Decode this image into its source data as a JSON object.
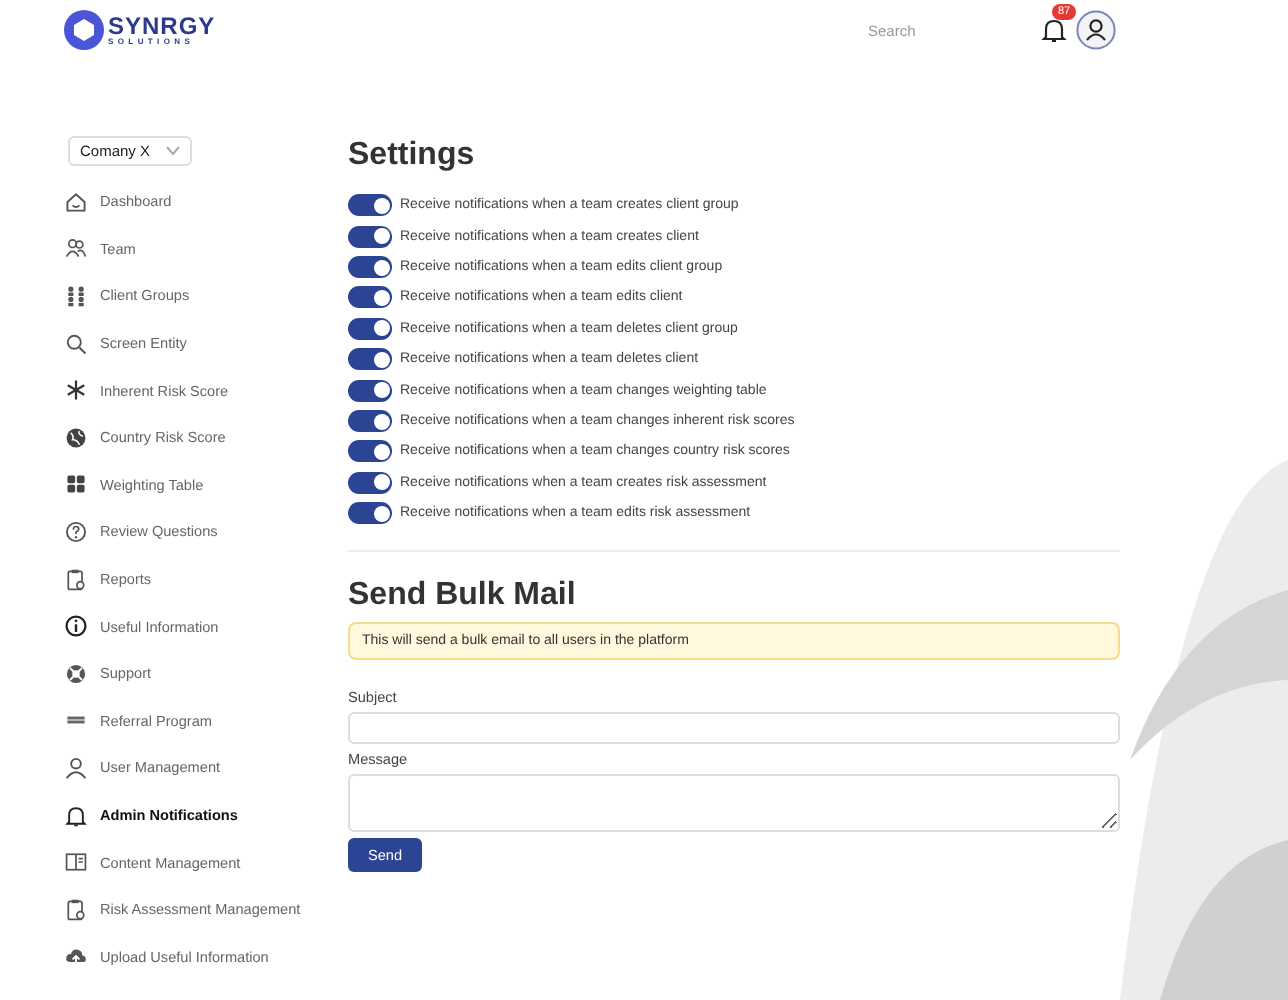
{
  "header": {
    "logo_name": "SYNRGY",
    "logo_sub": "SOLUTIONS",
    "search": {
      "placeholder": "Search"
    },
    "notification_count": "87"
  },
  "sidebar": {
    "company_select": "Comany X",
    "items": [
      {
        "label": "Dashboard",
        "selected": false
      },
      {
        "label": "Team",
        "selected": false
      },
      {
        "label": "Client Groups",
        "selected": false
      },
      {
        "label": "Screen Entity",
        "selected": false
      },
      {
        "label": "Inherent Risk Score",
        "selected": false
      },
      {
        "label": "Country Risk Score",
        "selected": false
      },
      {
        "label": "Weighting Table",
        "selected": false
      },
      {
        "label": "Review Questions",
        "selected": false
      },
      {
        "label": "Reports",
        "selected": false
      },
      {
        "label": "Useful Information",
        "selected": false
      },
      {
        "label": "Support",
        "selected": false
      },
      {
        "label": "Referral Program",
        "selected": false
      },
      {
        "label": "User Management",
        "selected": false
      },
      {
        "label": "Admin Notifications",
        "selected": true
      },
      {
        "label": "Content Management",
        "selected": false
      },
      {
        "label": "Risk Assessment Management",
        "selected": false
      },
      {
        "label": "Upload Useful Information",
        "selected": false
      }
    ]
  },
  "settings": {
    "title": "Settings",
    "toggles": [
      {
        "label": "Receive notifications when a team creates client group",
        "on": true
      },
      {
        "label": "Receive notifications when a team creates client",
        "on": true
      },
      {
        "label": "Receive notifications when a team edits client group",
        "on": true
      },
      {
        "label": "Receive notifications when a team edits client",
        "on": true
      },
      {
        "label": "Receive notifications when a team deletes client group",
        "on": true
      },
      {
        "label": "Receive notifications when a team deletes client",
        "on": true
      },
      {
        "label": "Receive notifications when a team changes weighting table",
        "on": true
      },
      {
        "label": "Receive notifications when a team changes inherent risk scores",
        "on": true
      },
      {
        "label": "Receive notifications when a team changes country risk scores",
        "on": true
      },
      {
        "label": "Receive notifications when a team creates risk assessment",
        "on": true
      },
      {
        "label": "Receive notifications when a team edits risk assessment",
        "on": true
      }
    ]
  },
  "bulk_mail": {
    "title": "Send Bulk Mail",
    "notice": "This will send a bulk email to all users in the platform",
    "subject_label": "Subject",
    "message_label": "Message",
    "send_button": "Send"
  }
}
